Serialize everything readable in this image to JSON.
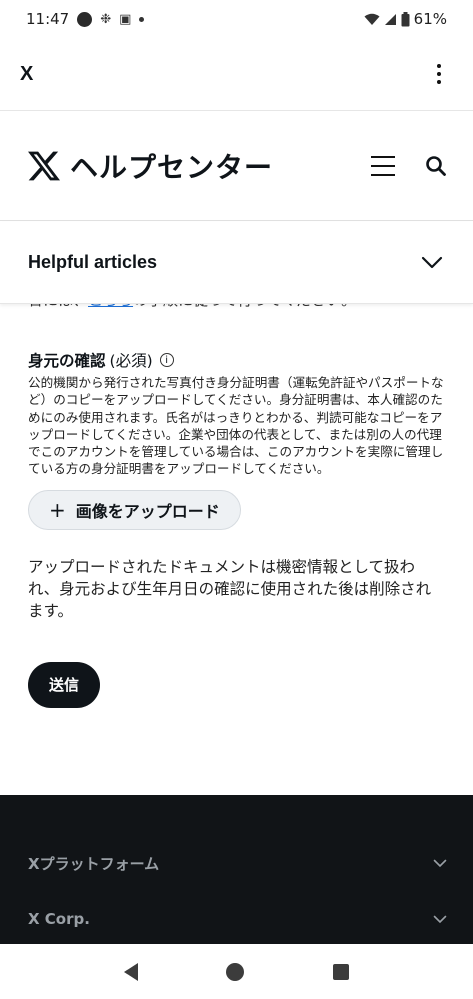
{
  "status_bar": {
    "time": "11:47",
    "battery": "61%"
  },
  "app_bar": {
    "title": "X"
  },
  "help_header": {
    "title": "ヘルプセンター"
  },
  "articles": {
    "title": "Helpful articles"
  },
  "content": {
    "cut_prefix": "合には、",
    "cut_link": "こちら",
    "cut_suffix": "の手順に従って行ってください。",
    "section_heading": "身元の確認",
    "section_required": "(必須)",
    "id_description": "公的機関から発行された写真付き身分証明書（運転免許証やパスポートなど）のコピーをアップロードしてください。身分証明書は、本人確認のためにのみ使用されます。氏名がはっきりとわかる、判読可能なコピーをアップロードしてください。企業や団体の代表として、または別の人の代理でこのアカウントを管理している場合は、このアカウントを実際に管理している方の身分証明書をアップロードしてください。",
    "upload_button": "画像をアップロード",
    "privacy_note": "アップロードされたドキュメントは機密情報として扱われ、身元および生年月日の確認に使用された後は削除されます。",
    "submit_button": "送信"
  },
  "footer": {
    "items": [
      {
        "label": "Xプラットフォーム"
      },
      {
        "label": "X Corp."
      }
    ]
  },
  "icons": {
    "x_logo": "x-logo-icon",
    "menu": "hamburger-icon",
    "search": "search-icon",
    "expand": "chevron-down-icon",
    "info": "info-icon",
    "more": "more-vertical-icon"
  }
}
